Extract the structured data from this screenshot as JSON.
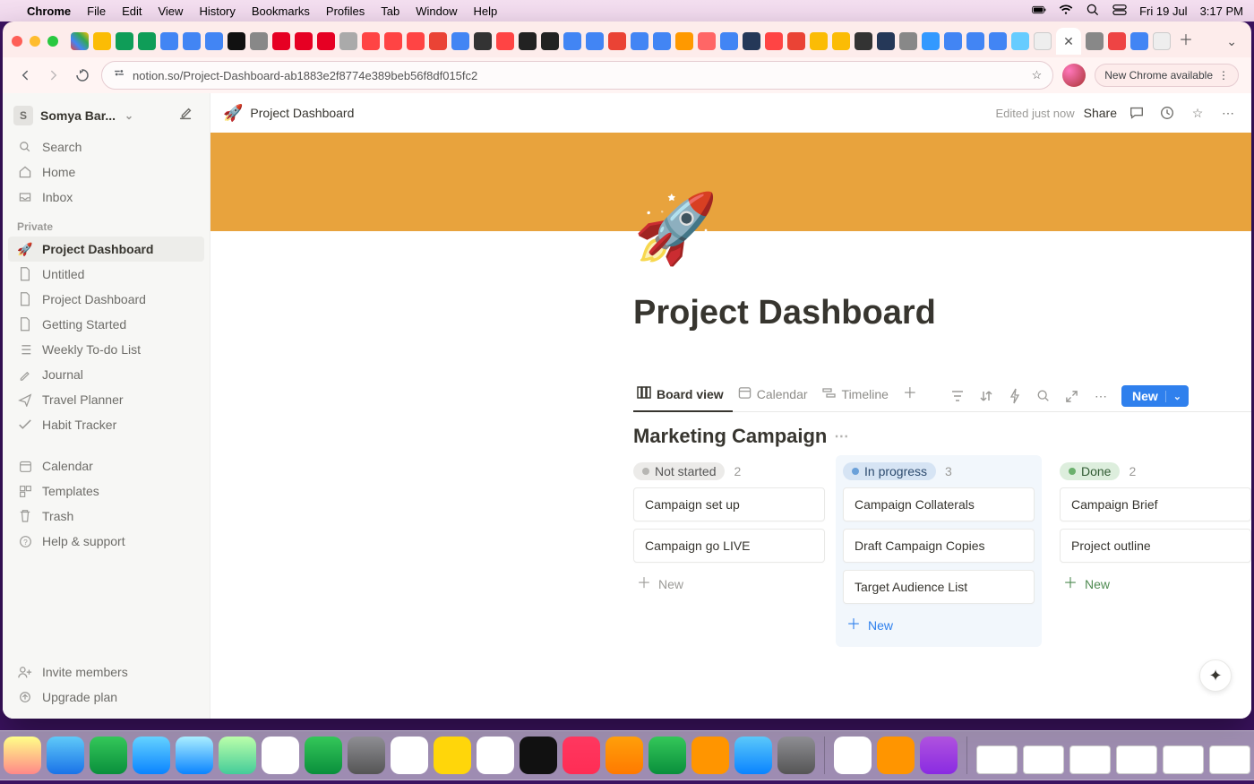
{
  "mac": {
    "menus": [
      "Chrome",
      "File",
      "Edit",
      "View",
      "History",
      "Bookmarks",
      "Profiles",
      "Tab",
      "Window",
      "Help"
    ],
    "date": "Fri 19 Jul",
    "time": "3:17 PM"
  },
  "chrome": {
    "url": "notion.so/Project-Dashboard-ab1883e2f8774e389beb56f8df015fc2",
    "update_label": "New Chrome available",
    "tab_close": "✕"
  },
  "notion": {
    "user": "Somya Bar...",
    "user_initial": "S",
    "nav": {
      "search": "Search",
      "home": "Home",
      "inbox": "Inbox"
    },
    "section_private": "Private",
    "pages": [
      {
        "icon": "🚀",
        "label": "Project Dashboard",
        "active": true
      },
      {
        "icon": "page",
        "label": "Untitled"
      },
      {
        "icon": "page",
        "label": "Project Dashboard"
      },
      {
        "icon": "page",
        "label": "Getting Started"
      },
      {
        "icon": "list",
        "label": "Weekly To-do List"
      },
      {
        "icon": "pencil",
        "label": "Journal"
      },
      {
        "icon": "plane",
        "label": "Travel Planner"
      },
      {
        "icon": "check",
        "label": "Habit Tracker"
      }
    ],
    "footer": {
      "calendar": "Calendar",
      "templates": "Templates",
      "trash": "Trash",
      "help": "Help & support",
      "invite": "Invite members",
      "upgrade": "Upgrade plan"
    },
    "topbar": {
      "emoji": "🚀",
      "title": "Project Dashboard",
      "status": "Edited just now",
      "share": "Share"
    },
    "page": {
      "emoji": "🚀",
      "title": "Project Dashboard"
    },
    "db": {
      "views": [
        {
          "icon": "board",
          "label": "Board view",
          "active": true
        },
        {
          "icon": "calendar",
          "label": "Calendar"
        },
        {
          "icon": "timeline",
          "label": "Timeline"
        }
      ],
      "new_label": "New",
      "title": "Marketing Campaign",
      "columns": [
        {
          "key": "ns",
          "name": "Not started",
          "style": "grey",
          "count": 2,
          "cards": [
            "Campaign set up",
            "Campaign go LIVE"
          ],
          "add_style": "grey"
        },
        {
          "key": "ip",
          "name": "In progress",
          "style": "blue",
          "count": 3,
          "cards": [
            "Campaign Collaterals",
            "Draft Campaign Copies",
            "Target Audience List"
          ],
          "add_style": "blue"
        },
        {
          "key": "dn",
          "name": "Done",
          "style": "green",
          "count": 2,
          "cards": [
            "Campaign Brief",
            "Project outline"
          ],
          "add_style": "green"
        }
      ],
      "add_new": "New"
    }
  }
}
